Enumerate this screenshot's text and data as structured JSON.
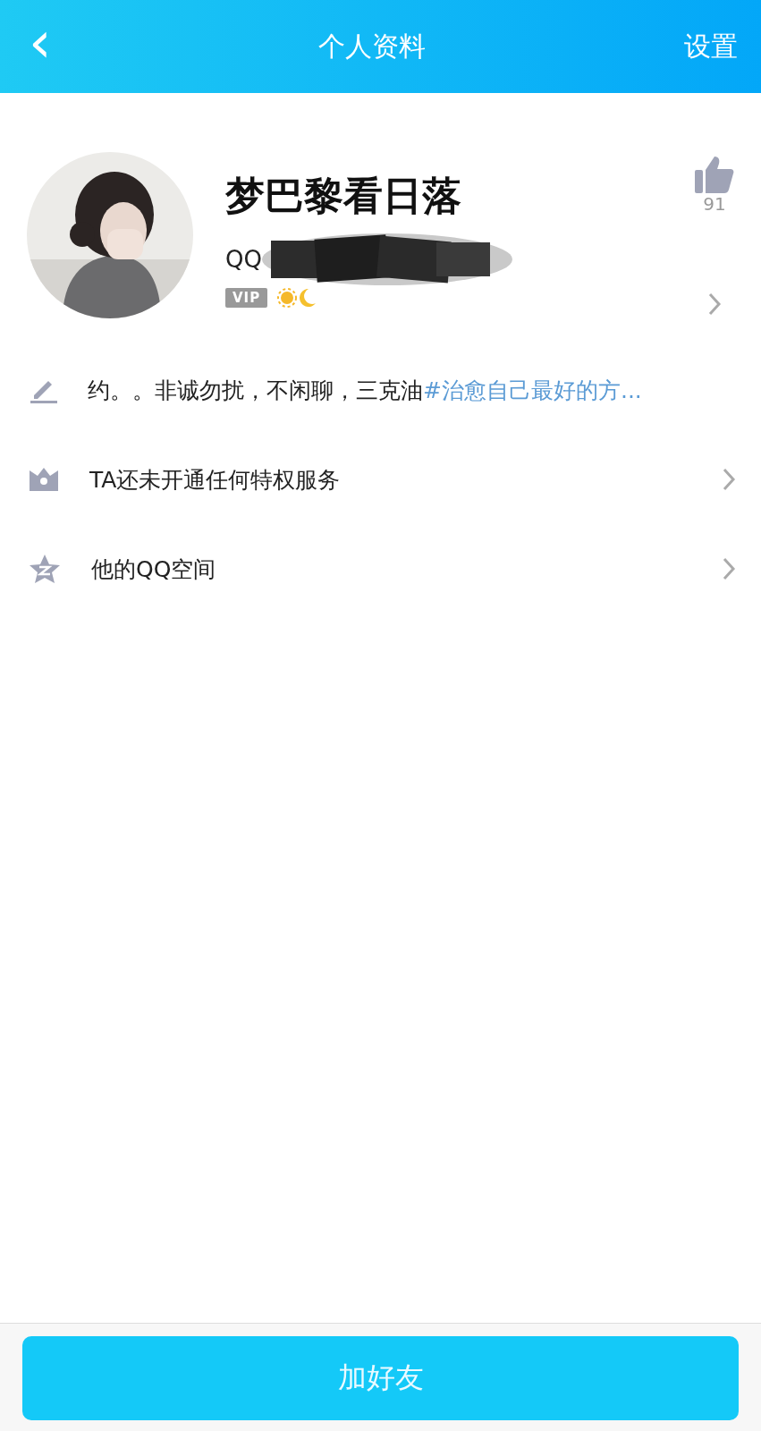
{
  "header": {
    "back": "‹",
    "title": "个人资料",
    "action": "设置"
  },
  "profile": {
    "name": "梦巴黎看日落",
    "qq_label": "QQ",
    "badge": "VIP",
    "likes": "91"
  },
  "bio": {
    "text": "约。。非诚勿扰，不闲聊，三克油",
    "tag": "#治愈自己最好的方..."
  },
  "rows": [
    {
      "kind": "privilege",
      "label": "TA还未开通任何特权服务"
    },
    {
      "kind": "qzone",
      "label": "他的QQ空间"
    }
  ],
  "footer": {
    "button": "加好友"
  }
}
